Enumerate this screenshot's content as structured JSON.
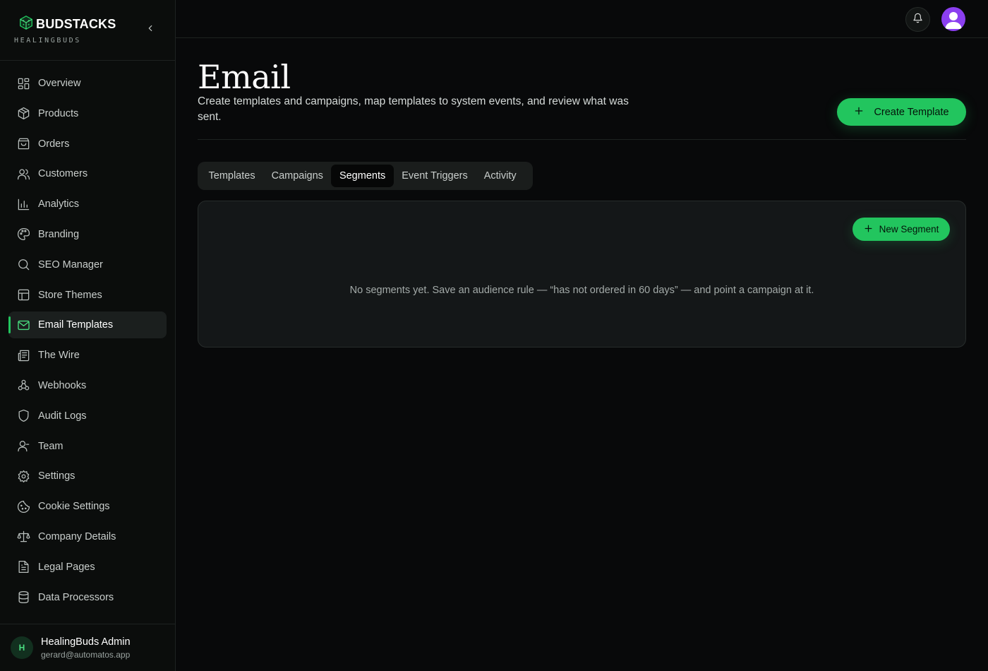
{
  "brand": {
    "name": "BUDSTACKS",
    "subtitle": "HEALINGBUDS",
    "logo_icon": "cube-logo-icon",
    "accent_color": "#22c55e"
  },
  "sidebar": {
    "items": [
      {
        "label": "Overview",
        "icon": "grid-icon"
      },
      {
        "label": "Products",
        "icon": "package-icon"
      },
      {
        "label": "Orders",
        "icon": "shopping-bag-icon"
      },
      {
        "label": "Customers",
        "icon": "users-icon"
      },
      {
        "label": "Analytics",
        "icon": "bar-chart-icon"
      },
      {
        "label": "Branding",
        "icon": "palette-icon"
      },
      {
        "label": "SEO Manager",
        "icon": "search-icon"
      },
      {
        "label": "Store Themes",
        "icon": "layout-icon"
      },
      {
        "label": "Email Templates",
        "icon": "mail-icon",
        "active": true
      },
      {
        "label": "The Wire",
        "icon": "newspaper-icon"
      },
      {
        "label": "Webhooks",
        "icon": "webhook-icon"
      },
      {
        "label": "Audit Logs",
        "icon": "shield-icon"
      },
      {
        "label": "Team",
        "icon": "user-icon"
      },
      {
        "label": "Settings",
        "icon": "gear-icon"
      },
      {
        "label": "Cookie Settings",
        "icon": "cookie-icon"
      },
      {
        "label": "Company Details",
        "icon": "scale-icon"
      },
      {
        "label": "Legal Pages",
        "icon": "file-text-icon"
      },
      {
        "label": "Data Processors",
        "icon": "database-icon"
      }
    ]
  },
  "user": {
    "initial": "H",
    "name": "HealingBuds Admin",
    "email": "gerard@automatos.app"
  },
  "header": {
    "title": "Email",
    "description": "Create templates and campaigns, map templates to system events, and review what was sent.",
    "create_button": "Create Template"
  },
  "tabs": [
    {
      "label": "Templates"
    },
    {
      "label": "Campaigns"
    },
    {
      "label": "Segments",
      "active": true
    },
    {
      "label": "Event Triggers"
    },
    {
      "label": "Activity"
    }
  ],
  "segments_panel": {
    "new_button": "New Segment",
    "empty_message": "No segments yet. Save an audience rule — “has not ordered in 60 days” — and point a campaign at it."
  }
}
